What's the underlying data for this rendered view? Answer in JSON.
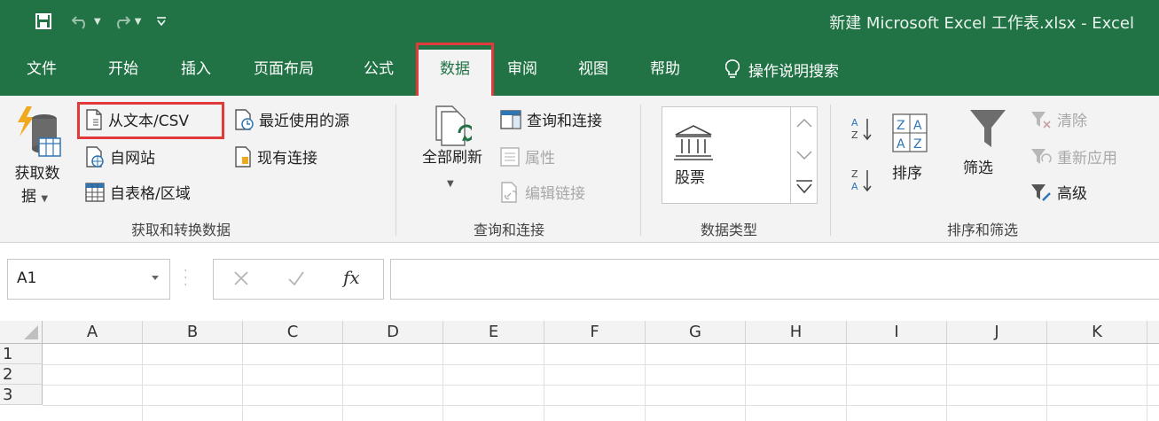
{
  "window": {
    "title": "新建 Microsoft Excel 工作表.xlsx  -  Excel"
  },
  "quick_access": [
    {
      "icon": "save-icon"
    },
    {
      "icon": "undo-icon"
    },
    {
      "icon": "redo-icon"
    },
    {
      "icon": "customize-qat-icon"
    }
  ],
  "tabs": {
    "file": "文件",
    "home": "开始",
    "insert": "插入",
    "page_layout": "页面布局",
    "formulas": "公式",
    "data": "数据",
    "review": "审阅",
    "view": "视图",
    "help": "帮助",
    "tell_me": "操作说明搜索"
  },
  "ribbon": {
    "get_transform": {
      "label": "获取和转换数据",
      "get_data_line1": "获取数",
      "get_data_line2": "据",
      "from_text_csv": "从文本/CSV",
      "from_web": "自网站",
      "from_table": "自表格/区域",
      "recent_sources": "最近使用的源",
      "existing_connections": "现有连接"
    },
    "queries": {
      "label": "查询和连接",
      "refresh_all": "全部刷新",
      "queries_connections": "查询和连接",
      "properties": "属性",
      "edit_links": "编辑链接"
    },
    "data_types": {
      "label": "数据类型",
      "stocks": "股票"
    },
    "sort_filter": {
      "label": "排序和筛选",
      "sort": "排序",
      "filter": "筛选",
      "clear": "清除",
      "reapply": "重新应用",
      "advanced": "高级"
    }
  },
  "formula_bar": {
    "name_box": "A1",
    "formula": ""
  },
  "sheet": {
    "columns": [
      "A",
      "B",
      "C",
      "D",
      "E",
      "F",
      "G",
      "H",
      "I",
      "J",
      "K"
    ],
    "rows": [
      "1",
      "2",
      "3"
    ]
  },
  "colors": {
    "excel_green": "#217346",
    "highlight_red": "#e03a3a"
  }
}
